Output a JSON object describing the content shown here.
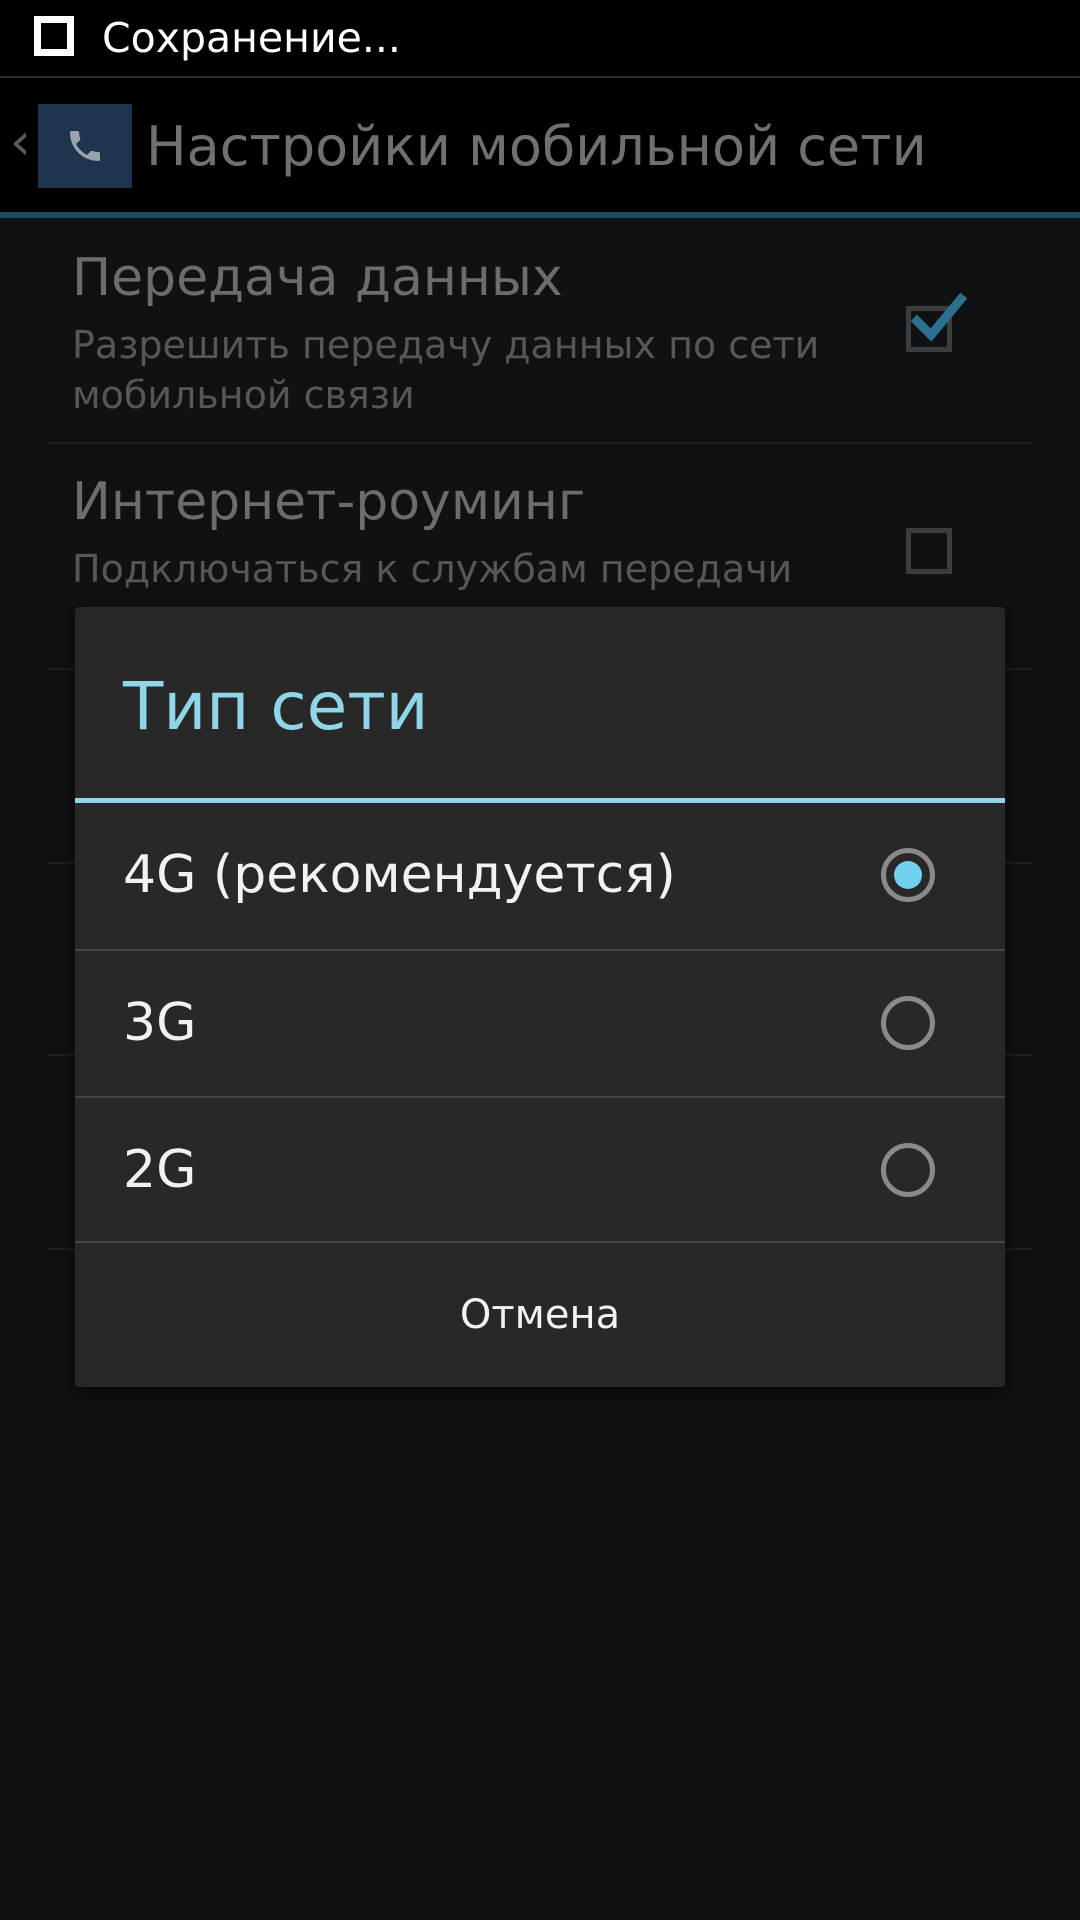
{
  "status_bar": {
    "notification_text": "Сохранение..."
  },
  "action_bar": {
    "title": "Настройки мобильной сети",
    "icon": "phone-icon"
  },
  "preferences": [
    {
      "title": "Передача данных",
      "summary": "Разрешить передачу данных по сети мобильной связи",
      "checked": true
    },
    {
      "title": "Интернет-роуминг",
      "summary": "Подключаться к службам передачи",
      "checked": false
    }
  ],
  "dialog": {
    "title": "Тип сети",
    "options": [
      {
        "label": "4G (рекомендуется)",
        "selected": true
      },
      {
        "label": "3G",
        "selected": false
      },
      {
        "label": "2G",
        "selected": false
      }
    ],
    "cancel_label": "Отмена"
  },
  "colors": {
    "accent": "#8fd6e9",
    "radio_selected": "#6fd1ec",
    "dialog_bg": "#282828",
    "screen_bg": "#0f1113"
  }
}
